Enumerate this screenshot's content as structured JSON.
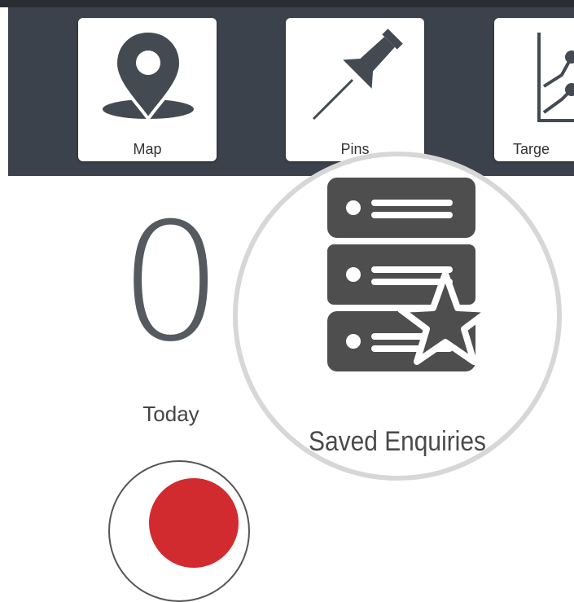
{
  "toolbar": {
    "tiles": [
      {
        "label": "Map",
        "icon": "map-pin-icon"
      },
      {
        "label": "Pins",
        "icon": "pushpin-icon"
      },
      {
        "label": "Targe",
        "icon": "line-chart-icon"
      }
    ]
  },
  "stats": {
    "count": "0",
    "period": "Today"
  },
  "magnified": {
    "label": "Saved Enquiries",
    "icon": "saved-enquiries-icon"
  },
  "colors": {
    "toolbar_bg": "#3c424c",
    "icon_fill": "#444a52",
    "accent_red": "#d12b2f"
  }
}
